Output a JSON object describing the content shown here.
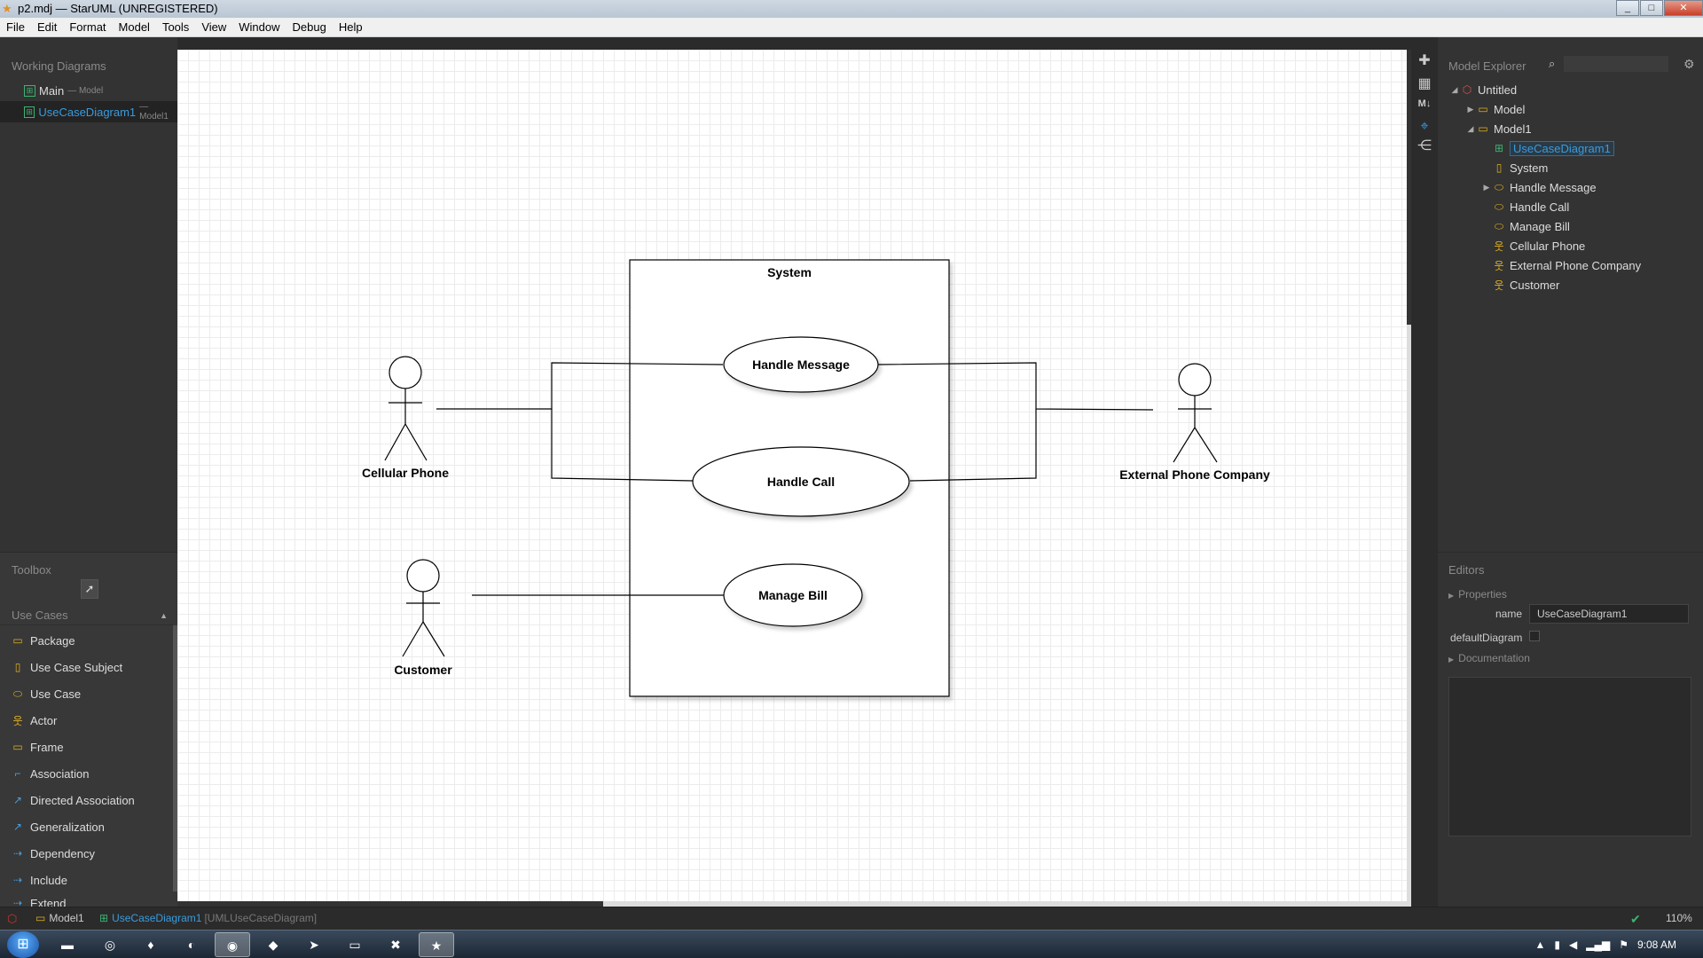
{
  "window": {
    "title": "p2.mdj — StarUML (UNREGISTERED)"
  },
  "menu": [
    "File",
    "Edit",
    "Format",
    "Model",
    "Tools",
    "View",
    "Window",
    "Debug",
    "Help"
  ],
  "working_diagrams": {
    "heading": "Working Diagrams",
    "items": [
      {
        "name": "Main",
        "context": "— Model"
      },
      {
        "name": "UseCaseDiagram1",
        "context": "— Model1"
      }
    ]
  },
  "toolbox": {
    "heading": "Toolbox",
    "section": "Use Cases",
    "items": [
      "Package",
      "Use Case Subject",
      "Use Case",
      "Actor",
      "Frame",
      "Association",
      "Directed Association",
      "Generalization",
      "Dependency",
      "Include",
      "Extend"
    ]
  },
  "diagram": {
    "subject": "System",
    "use_cases": [
      "Handle Message",
      "Handle Call",
      "Manage Bill"
    ],
    "actors": [
      "Cellular Phone",
      "External Phone Company",
      "Customer"
    ]
  },
  "model_explorer": {
    "heading": "Model Explorer",
    "search_placeholder": "",
    "tree": [
      {
        "label": "Untitled",
        "icon": "project-icon"
      },
      {
        "label": "Model",
        "icon": "model-icon"
      },
      {
        "label": "Model1",
        "icon": "model-icon"
      },
      {
        "label": "UseCaseDiagram1",
        "icon": "diagram-icon"
      },
      {
        "label": "System",
        "icon": "subject-icon"
      },
      {
        "label": "Handle Message",
        "icon": "usecase-icon"
      },
      {
        "label": "Handle Call",
        "icon": "usecase-icon"
      },
      {
        "label": "Manage Bill",
        "icon": "usecase-icon"
      },
      {
        "label": "Cellular Phone",
        "icon": "actor-icon"
      },
      {
        "label": "External Phone Company",
        "icon": "actor-icon"
      },
      {
        "label": "Customer",
        "icon": "actor-icon"
      }
    ]
  },
  "editors": {
    "heading": "Editors",
    "properties_label": "Properties",
    "name_label": "name",
    "name_value": "UseCaseDiagram1",
    "default_diagram_label": "defaultDiagram",
    "documentation_label": "Documentation"
  },
  "status": {
    "model": "Model1",
    "diagram": "UseCaseDiagram1",
    "diagram_type": "[UMLUseCaseDiagram]",
    "zoom": "110%"
  },
  "taskbar": {
    "clock": "9:08 AM"
  },
  "colors": {
    "accent": "#3a9bdc",
    "panel": "#333333",
    "canvas": "#ffffff"
  }
}
